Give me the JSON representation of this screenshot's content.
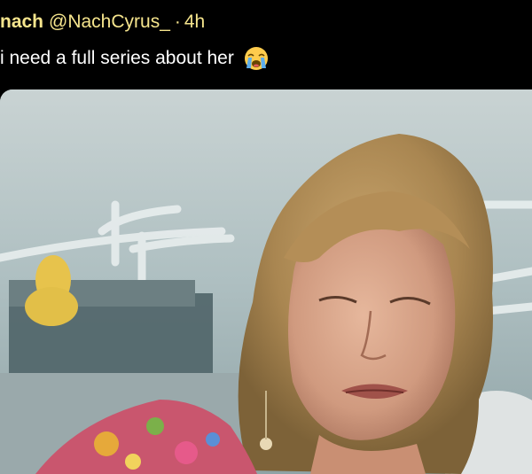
{
  "tweet": {
    "display_name": "nach",
    "handle": "@NachCyrus_",
    "separator": "·",
    "timestamp": "4h",
    "text": "i need a full series about her",
    "emoji_icon": "loudly-crying-face-icon"
  },
  "media": {
    "type": "video-still",
    "subject": "photo-woman-on-boat"
  },
  "colors": {
    "background": "#000000",
    "header_text": "#f6e58d",
    "body_text": "#ffffff"
  }
}
